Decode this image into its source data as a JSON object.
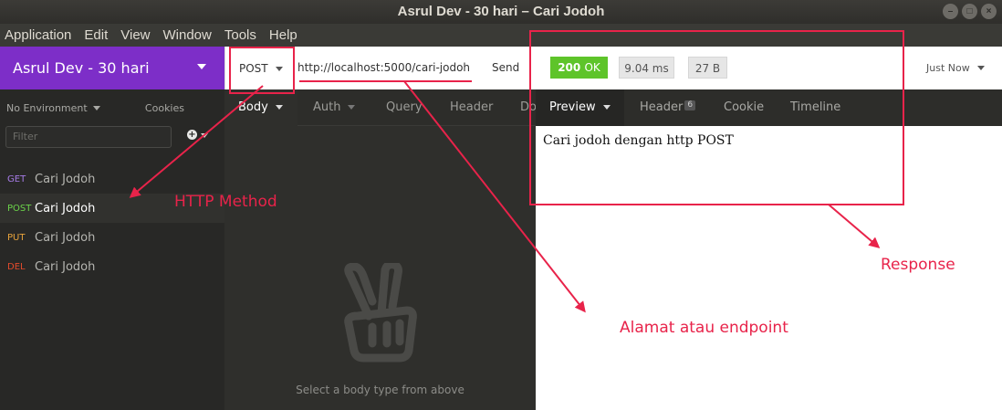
{
  "window": {
    "title": "Asrul Dev - 30 hari – Cari Jodoh",
    "controls": [
      "–",
      "□",
      "×"
    ]
  },
  "menu": [
    "Application",
    "Edit",
    "View",
    "Window",
    "Tools",
    "Help"
  ],
  "sidebar": {
    "workspace": "Asrul Dev - 30 hari",
    "environment": "No Environment",
    "cookies": "Cookies",
    "filter_placeholder": "Filter",
    "requests": [
      {
        "method": "GET",
        "name": "Cari Jodoh"
      },
      {
        "method": "POST",
        "name": "Cari Jodoh"
      },
      {
        "method": "PUT",
        "name": "Cari Jodoh"
      },
      {
        "method": "DEL",
        "name": "Cari Jodoh"
      }
    ]
  },
  "urlbar": {
    "method": "POST",
    "url": "http://localhost:5000/cari-jodoh",
    "send": "Send",
    "status_code": "200",
    "status_text": "OK",
    "time": "9.04 ms",
    "size": "27 B",
    "history": "Just Now"
  },
  "request_tabs": [
    "Body",
    "Auth",
    "Query",
    "Header",
    "Do"
  ],
  "request_body_empty": "Select a body type from above",
  "response_tabs": {
    "preview": "Preview",
    "header": "Header",
    "header_count": "6",
    "cookie": "Cookie",
    "timeline": "Timeline"
  },
  "response_body": "Cari jodoh dengan http POST",
  "annotations": {
    "method": "HTTP Method",
    "endpoint": "Alamat atau endpoint",
    "response": "Response",
    "color": "#e8234a"
  },
  "colors": {
    "workspace": "#7d2ec8",
    "status_ok": "#5ec42a",
    "get": "#a77ce8",
    "post": "#6bd34a",
    "put": "#e8a43c",
    "del": "#e44b2c"
  }
}
